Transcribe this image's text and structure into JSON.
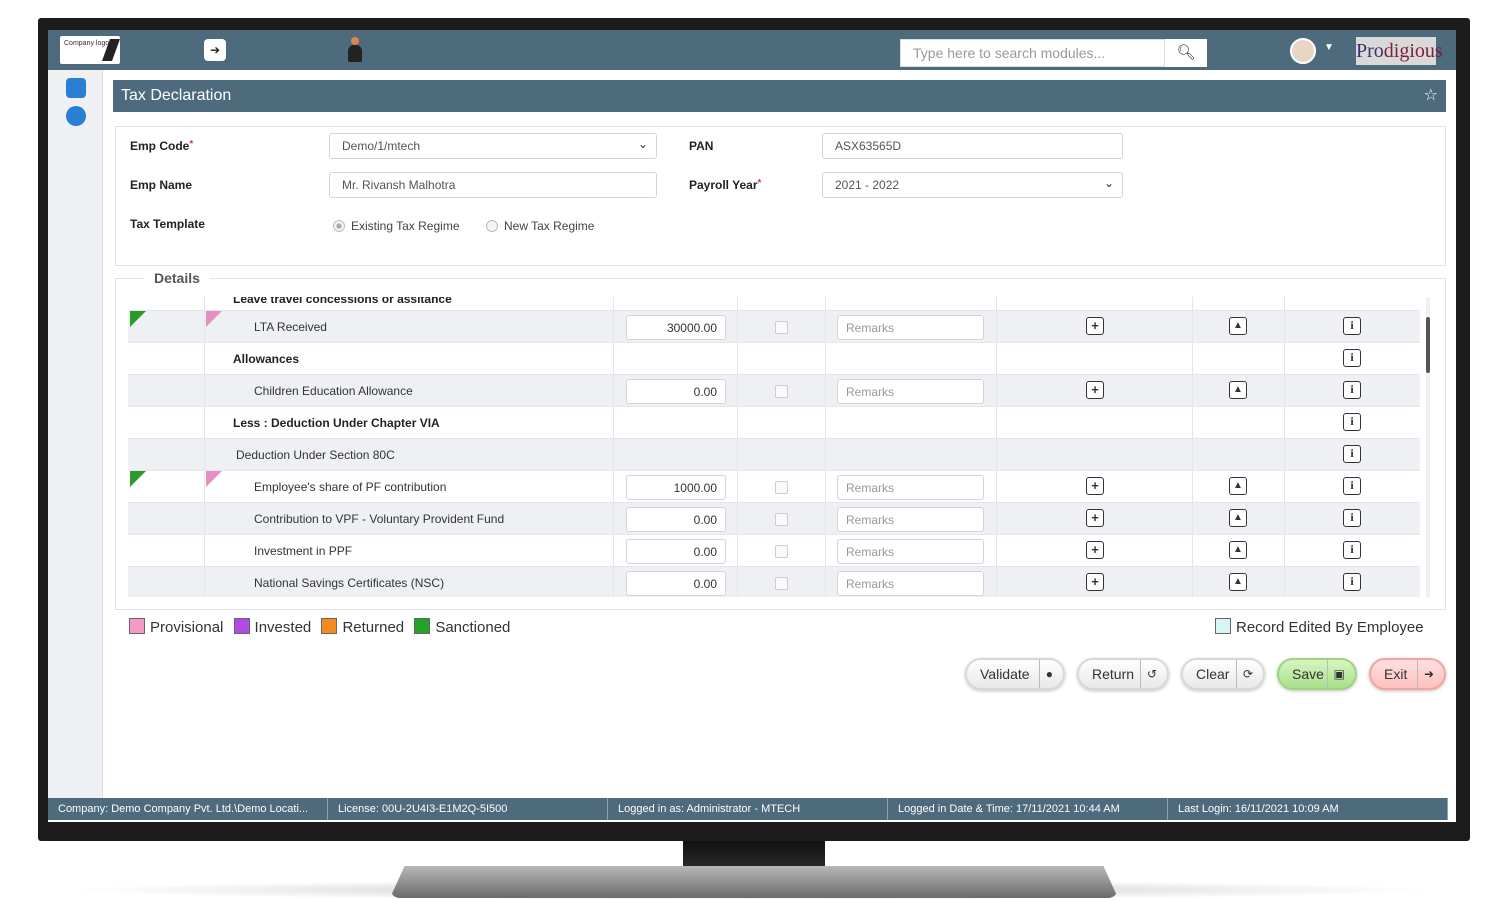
{
  "topbar": {
    "logo_text": "Company logo",
    "search_placeholder": "Type here to search modules...",
    "brand_pro": "Pro",
    "brand_rest": "digious"
  },
  "page": {
    "title": "Tax Declaration"
  },
  "form": {
    "emp_code_label": "Emp Code",
    "emp_code_value": "Demo/1/mtech",
    "pan_label": "PAN",
    "pan_value": "ASX63565D",
    "emp_name_label": "Emp Name",
    "emp_name_value": "Mr. Rivansh  Malhotra",
    "payroll_year_label": "Payroll Year",
    "payroll_year_value": "2021 - 2022",
    "tax_template_label": "Tax Template",
    "regime_existing": "Existing Tax Regime",
    "regime_new": "New Tax Regime"
  },
  "details": {
    "legend": "Details",
    "partial_header": "Leave travel concessions or assitance",
    "rows": [
      {
        "label": "LTA Received",
        "amount": "30000.00",
        "remarks": "Remarks"
      },
      {
        "label": "Allowances"
      },
      {
        "label": "Children Education Allowance",
        "amount": "0.00",
        "remarks": "Remarks"
      },
      {
        "label": "Less : Deduction Under Chapter VIA"
      },
      {
        "label": "Deduction Under Section 80C"
      },
      {
        "label": "Employee's share of PF contribution",
        "amount": "1000.00",
        "remarks": "Remarks"
      },
      {
        "label": "Contribution to VPF - Voluntary Provident Fund",
        "amount": "0.00",
        "remarks": "Remarks"
      },
      {
        "label": "Investment in PPF",
        "amount": "0.00",
        "remarks": "Remarks"
      },
      {
        "label": "National Savings Certificates (NSC)",
        "amount": "0.00",
        "remarks": "Remarks"
      }
    ]
  },
  "legend": {
    "provisional": "Provisional",
    "invested": "Invested",
    "returned": "Returned",
    "sanctioned": "Sanctioned",
    "edited": "Record Edited By Employee",
    "colors": {
      "provisional": "#f39ac7",
      "invested": "#b14be8",
      "returned": "#f58a1f",
      "sanctioned": "#22a32a",
      "edited": "#d6f5f5"
    }
  },
  "actions": {
    "validate": "Validate",
    "return": "Return",
    "clear": "Clear",
    "save": "Save",
    "exit": "Exit"
  },
  "status": {
    "company": "Company: Demo Company Pvt. Ltd.\\Demo Locati...",
    "license": "License: 00U-2U4I3-E1M2Q-5I500",
    "logged_as": "Logged in as: Administrator - MTECH",
    "logged_time": "Logged in Date & Time: 17/11/2021 10:44 AM",
    "last_login": "Last Login: 16/11/2021 10:09 AM"
  }
}
